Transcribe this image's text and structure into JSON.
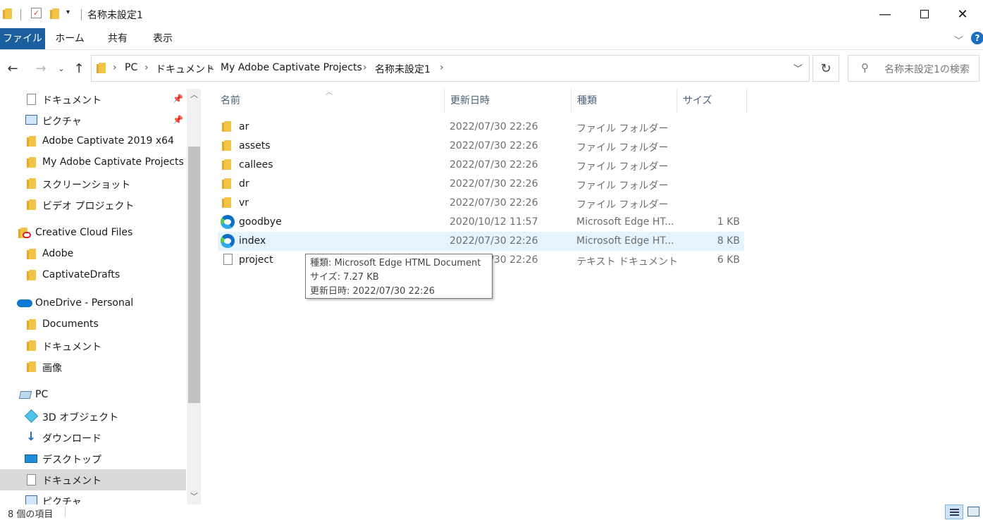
{
  "window": {
    "title": "名称未設定1"
  },
  "ribbon": {
    "tabs": [
      "ファイル",
      "ホーム",
      "共有",
      "表示"
    ]
  },
  "address": {
    "crumbs": [
      "PC",
      "ドキュメント",
      "My Adobe Captivate Projects",
      "名称未設定1"
    ],
    "search_placeholder": "名称未設定1の検索"
  },
  "nav": {
    "items": [
      {
        "label": "ドキュメント",
        "icon": "documents-icon",
        "pinned": true
      },
      {
        "label": "ピクチャ",
        "icon": "pictures-icon",
        "pinned": true
      },
      {
        "label": "Adobe Captivate 2019 x64",
        "icon": "folder-icon"
      },
      {
        "label": "My Adobe Captivate Projects",
        "icon": "folder-icon"
      },
      {
        "label": "スクリーンショット",
        "icon": "folder-icon"
      },
      {
        "label": "ビデオ プロジェクト",
        "icon": "folder-icon"
      },
      {
        "label": "Creative Cloud Files",
        "icon": "creative-cloud-icon"
      },
      {
        "label": "Adobe",
        "icon": "folder-icon"
      },
      {
        "label": "CaptivateDrafts",
        "icon": "folder-icon"
      },
      {
        "label": "OneDrive - Personal",
        "icon": "onedrive-icon"
      },
      {
        "label": "Documents",
        "icon": "folder-icon"
      },
      {
        "label": "ドキュメント",
        "icon": "folder-icon"
      },
      {
        "label": "画像",
        "icon": "folder-icon"
      },
      {
        "label": "PC",
        "icon": "pc-icon"
      },
      {
        "label": "3D オブジェクト",
        "icon": "3d-objects-icon"
      },
      {
        "label": "ダウンロード",
        "icon": "downloads-icon"
      },
      {
        "label": "デスクトップ",
        "icon": "desktop-icon"
      },
      {
        "label": "ドキュメント",
        "icon": "documents-icon",
        "selected": true
      },
      {
        "label": "ピクチャ",
        "icon": "pictures-icon"
      }
    ]
  },
  "list": {
    "columns": [
      "名前",
      "更新日時",
      "種類",
      "サイズ"
    ],
    "rows": [
      {
        "name": "ar",
        "date": "2022/07/30 22:26",
        "type": "ファイル フォルダー",
        "size": "",
        "icon": "folder-icon"
      },
      {
        "name": "assets",
        "date": "2022/07/30 22:26",
        "type": "ファイル フォルダー",
        "size": "",
        "icon": "folder-icon"
      },
      {
        "name": "callees",
        "date": "2022/07/30 22:26",
        "type": "ファイル フォルダー",
        "size": "",
        "icon": "folder-icon"
      },
      {
        "name": "dr",
        "date": "2022/07/30 22:26",
        "type": "ファイル フォルダー",
        "size": "",
        "icon": "folder-icon"
      },
      {
        "name": "vr",
        "date": "2022/07/30 22:26",
        "type": "ファイル フォルダー",
        "size": "",
        "icon": "folder-icon"
      },
      {
        "name": "goodbye",
        "date": "2020/10/12 11:57",
        "type": "Microsoft Edge HT...",
        "size": "1 KB",
        "icon": "edge-icon"
      },
      {
        "name": "index",
        "date": "2022/07/30 22:26",
        "type": "Microsoft Edge HT...",
        "size": "8 KB",
        "icon": "edge-icon",
        "selected": true
      },
      {
        "name": "project",
        "date": "2022/07/30 22:26",
        "type": "テキスト ドキュメント",
        "size": "6 KB",
        "icon": "text-file-icon"
      }
    ]
  },
  "tooltip": {
    "line1": "種類: Microsoft Edge HTML Document",
    "line2": "サイズ: 7.27 KB",
    "line3": "更新日時: 2022/07/30 22:26"
  },
  "status": {
    "count": "8 個の項目"
  },
  "colors": {
    "file_tab": "#1b5f9e",
    "selection": "#e5f3ff",
    "nav_selection": "#d9d9d9"
  }
}
